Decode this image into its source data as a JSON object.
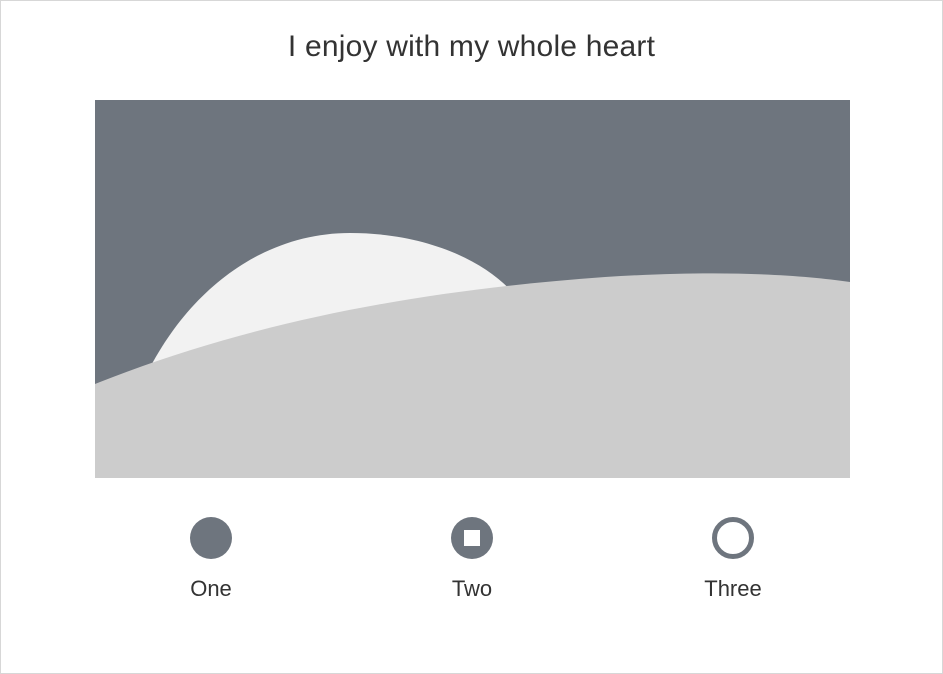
{
  "page": {
    "title": "I enjoy with my whole heart"
  },
  "hero_image": {
    "description_icon": "landscape-placeholder-icon",
    "colors": {
      "sky": "#6e757e",
      "sun": "#f2f2f2",
      "hill": "#cccccc"
    }
  },
  "options": [
    {
      "label": "One",
      "icon": "filled-circle-icon"
    },
    {
      "label": "Two",
      "icon": "circle-with-square-icon"
    },
    {
      "label": "Three",
      "icon": "ring-icon"
    }
  ],
  "colors": {
    "accent": "#6e757e",
    "text": "#333333",
    "border": "#d7d7d7",
    "background": "#ffffff"
  }
}
